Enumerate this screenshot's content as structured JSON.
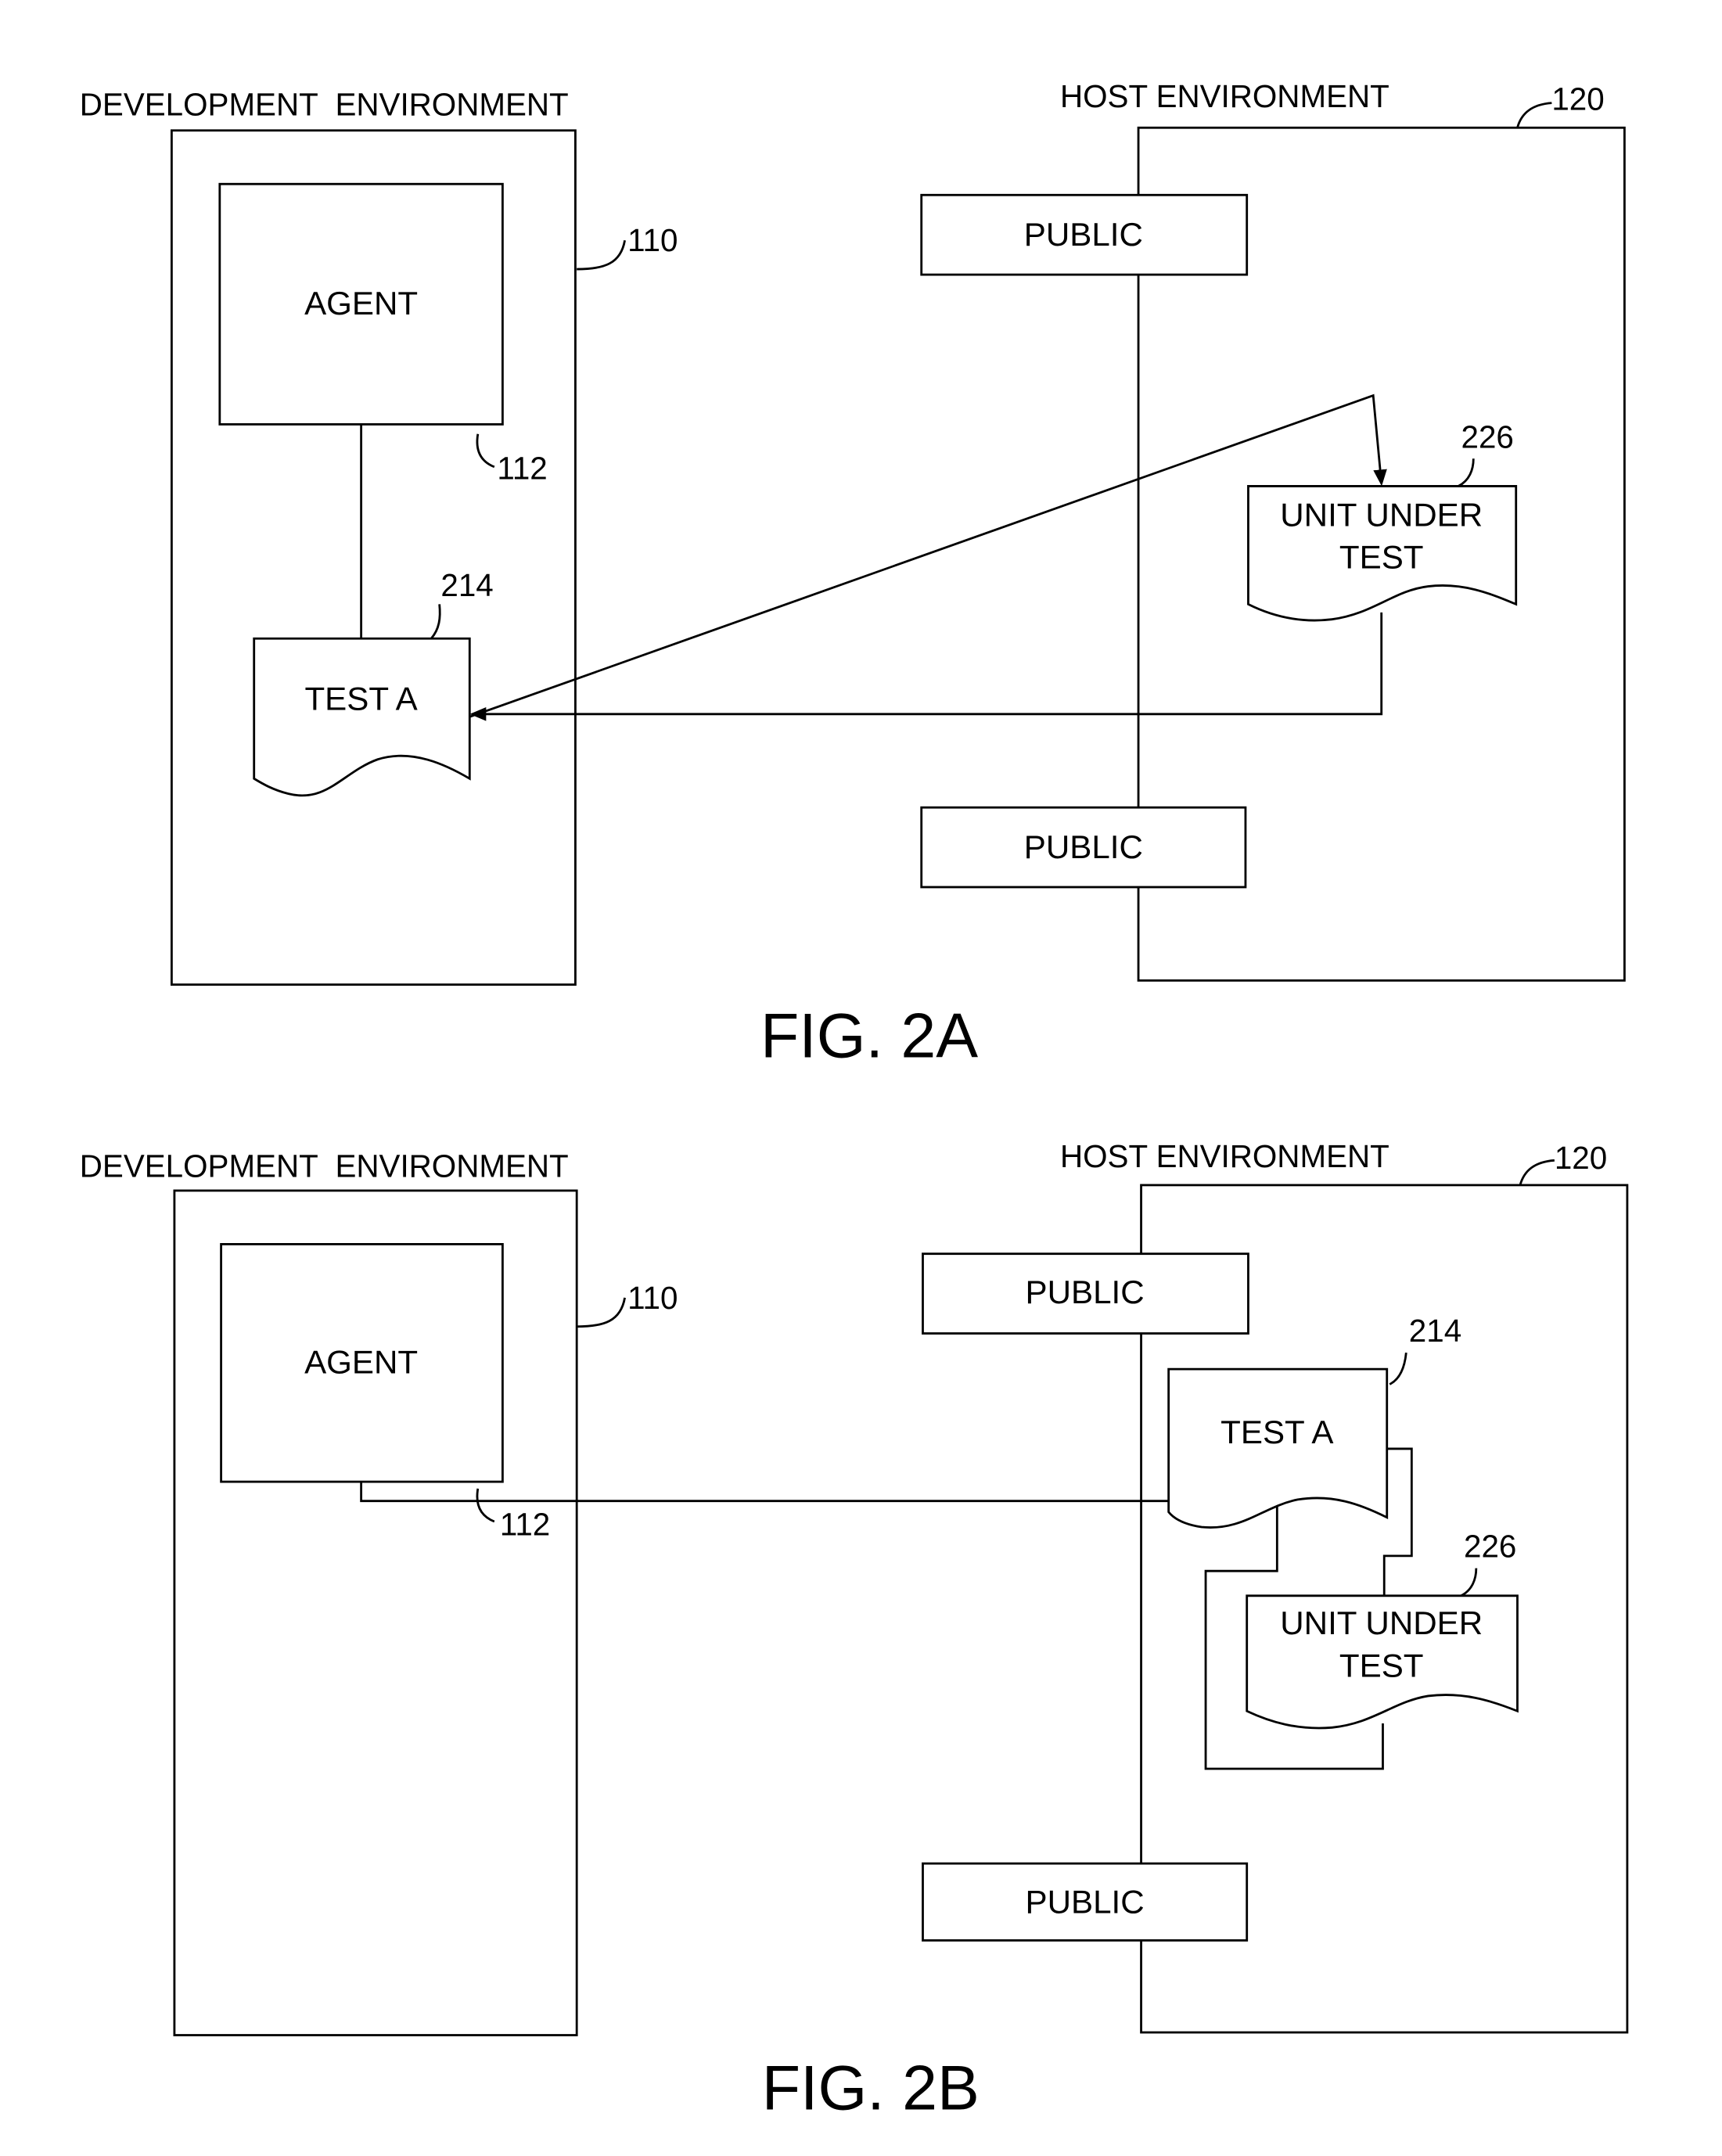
{
  "figures": [
    {
      "id": "2A",
      "caption": "FIG. 2A",
      "development_environment": {
        "label": "DEVELOPMENT  ENVIRONMENT",
        "ref": "110",
        "agent": {
          "label": "AGENT",
          "ref": "112"
        },
        "test": {
          "label": "TEST A",
          "ref": "214"
        }
      },
      "host_environment": {
        "label": "HOST ENVIRONMENT",
        "ref": "120",
        "public_top": "PUBLIC",
        "public_bottom": "PUBLIC",
        "unit_under_test": {
          "line1": "UNIT UNDER",
          "line2": "TEST",
          "ref": "226"
        }
      }
    },
    {
      "id": "2B",
      "caption": "FIG. 2B",
      "development_environment": {
        "label": "DEVELOPMENT  ENVIRONMENT",
        "ref": "110",
        "agent": {
          "label": "AGENT",
          "ref": "112"
        }
      },
      "host_environment": {
        "label": "HOST ENVIRONMENT",
        "ref": "120",
        "public_top": "PUBLIC",
        "public_bottom": "PUBLIC",
        "test": {
          "label": "TEST A",
          "ref": "214"
        },
        "unit_under_test": {
          "line1": "UNIT UNDER",
          "line2": "TEST",
          "ref": "226"
        }
      }
    }
  ]
}
